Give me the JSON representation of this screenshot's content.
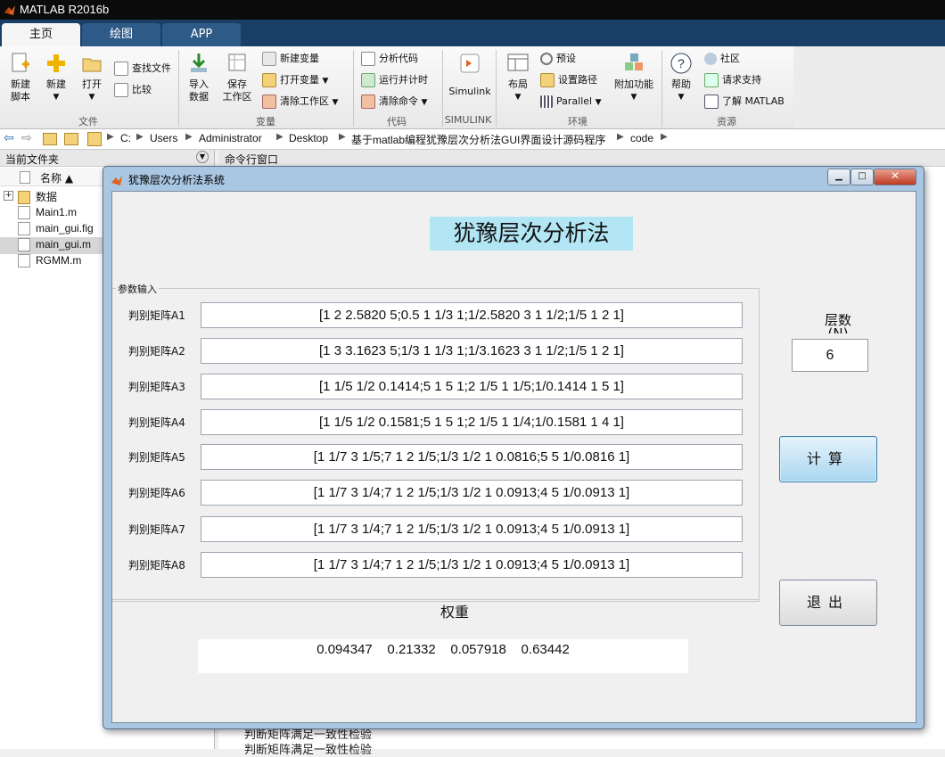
{
  "window": {
    "title": "MATLAB R2016b"
  },
  "tabs": [
    {
      "label": "主页"
    },
    {
      "label": "绘图"
    },
    {
      "label": "APP"
    }
  ],
  "ribbon": {
    "file": {
      "label": "文件",
      "new_script": "新建\n脚本",
      "new": "新建",
      "open": "打开",
      "find_files": "查找文件",
      "compare": "比较"
    },
    "variable": {
      "label": "变量",
      "import": "导入\n数据",
      "save_ws": "保存\n工作区",
      "new_var": "新建变量",
      "open_var": "打开变量",
      "clear_ws": "清除工作区"
    },
    "code": {
      "label": "代码",
      "analyze": "分析代码",
      "run_time": "运行并计时",
      "clear_cmd": "清除命令"
    },
    "simulink": {
      "label": "SIMULINK",
      "simulink": "Simulink"
    },
    "env": {
      "label": "环境",
      "layout": "布局",
      "prefs": "预设",
      "set_path": "设置路径",
      "parallel": "Parallel",
      "addons": "附加功能"
    },
    "resources": {
      "label": "资源",
      "help": "帮助",
      "community": "社区",
      "support": "请求支持",
      "learn": "了解 MATLAB"
    }
  },
  "address": {
    "crumbs": [
      "C:",
      "Users",
      "Administrator",
      "Desktop",
      "基于matlab编程犹豫层次分析法GUI界面设计源码程序",
      "code"
    ]
  },
  "left_panel": {
    "header": "当前文件夹",
    "col_name": "名称 ▲",
    "files": [
      "数据",
      "Main1.m",
      "main_gui.fig",
      "main_gui.m",
      "RGMM.m"
    ]
  },
  "cmd_panel": {
    "header": "命令行窗口",
    "lines": [
      "判断矩阵满足一致性检验",
      "判断矩阵满足一致性检验"
    ]
  },
  "dialog": {
    "title": "犹豫层次分析法系统",
    "heading": "犹豫层次分析法",
    "group_label": "参数输入",
    "matrices": [
      {
        "label": "判别矩阵A1",
        "value": "[1 2 2.5820 5;0.5 1 1/3 1;1/2.5820 3 1 1/2;1/5 1 2 1]"
      },
      {
        "label": "判别矩阵A2",
        "value": "[1 3 3.1623 5;1/3 1 1/3 1;1/3.1623 3 1 1/2;1/5 1 2 1]"
      },
      {
        "label": "判别矩阵A3",
        "value": "[1 1/5 1/2 0.1414;5 1 5 1;2 1/5 1 1/5;1/0.1414 1 5 1]"
      },
      {
        "label": "判别矩阵A4",
        "value": "[1 1/5 1/2 0.1581;5 1 5 1;2 1/5 1 1/4;1/0.1581 1 4 1]"
      },
      {
        "label": "判别矩阵A5",
        "value": "[1 1/7 3 1/5;7 1 2 1/5;1/3 1/2 1 0.0816;5 5 1/0.0816 1]"
      },
      {
        "label": "判别矩阵A6",
        "value": "[1 1/7 3 1/4;7 1 2 1/5;1/3 1/2 1 0.0913;4 5 1/0.0913 1]"
      },
      {
        "label": "判别矩阵A7",
        "value": "[1 1/7 3 1/4;7 1 2 1/5;1/3 1/2 1 0.0913;4 5 1/0.0913 1]"
      },
      {
        "label": "判别矩阵A8",
        "value": "[1 1/7 3 1/4;7 1 2 1/5;1/3 1/2 1 0.0913;4 5 1/0.0913 1]"
      }
    ],
    "layers_label": "层数\n(N)",
    "layers_value": "6",
    "calc_button": "计算",
    "exit_button": "退出",
    "weight_label": "权重",
    "weights": "0.094347    0.21332    0.057918    0.63442"
  },
  "colors": {
    "title_bg": "#0b0b0b",
    "tabstrip_bg": "#1a3f67",
    "heading_bg": "#b3e6f5",
    "calc_button_bg": "#aad6f0",
    "dialog_frame": "#a9c6e2"
  }
}
